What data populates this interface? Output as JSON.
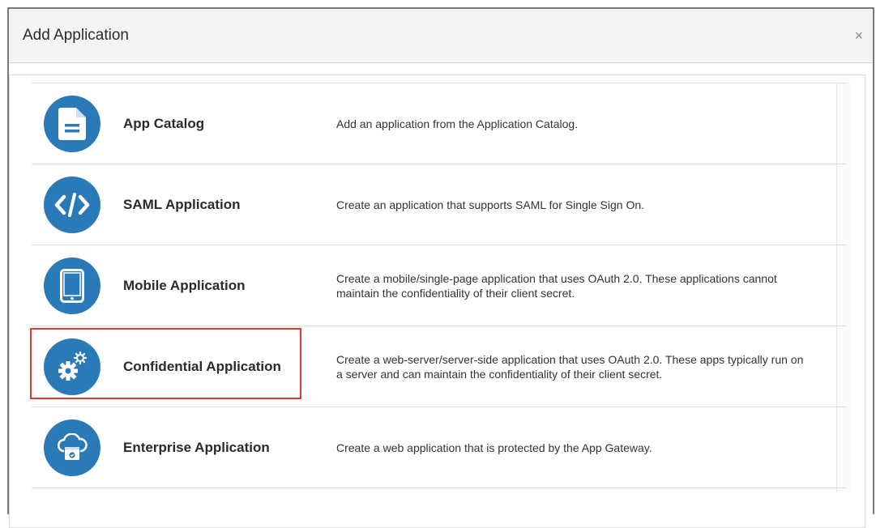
{
  "dialog": {
    "title": "Add Application",
    "close_label": "×"
  },
  "items": [
    {
      "name": "App Catalog",
      "description": "Add an application from the Application Catalog.",
      "icon": "document-icon"
    },
    {
      "name": "SAML Application",
      "description": "Create an application that supports SAML for Single Sign On.",
      "icon": "code-icon"
    },
    {
      "name": "Mobile Application",
      "description": "Create a mobile/single-page application that uses OAuth 2.0. These applications cannot maintain the confidentiality of their client secret.",
      "icon": "mobile-icon"
    },
    {
      "name": "Confidential Application",
      "description": "Create a web-server/server-side application that uses OAuth 2.0. These apps typically run on a server and can maintain the confidentiality of their client secret.",
      "icon": "gears-icon",
      "highlighted": true
    },
    {
      "name": "Enterprise Application",
      "description": "Create a web application that is protected by the App Gateway.",
      "icon": "cloud-app-icon"
    }
  ],
  "colors": {
    "icon_circle": "#2b7ab8",
    "highlight": "#e8352b"
  }
}
